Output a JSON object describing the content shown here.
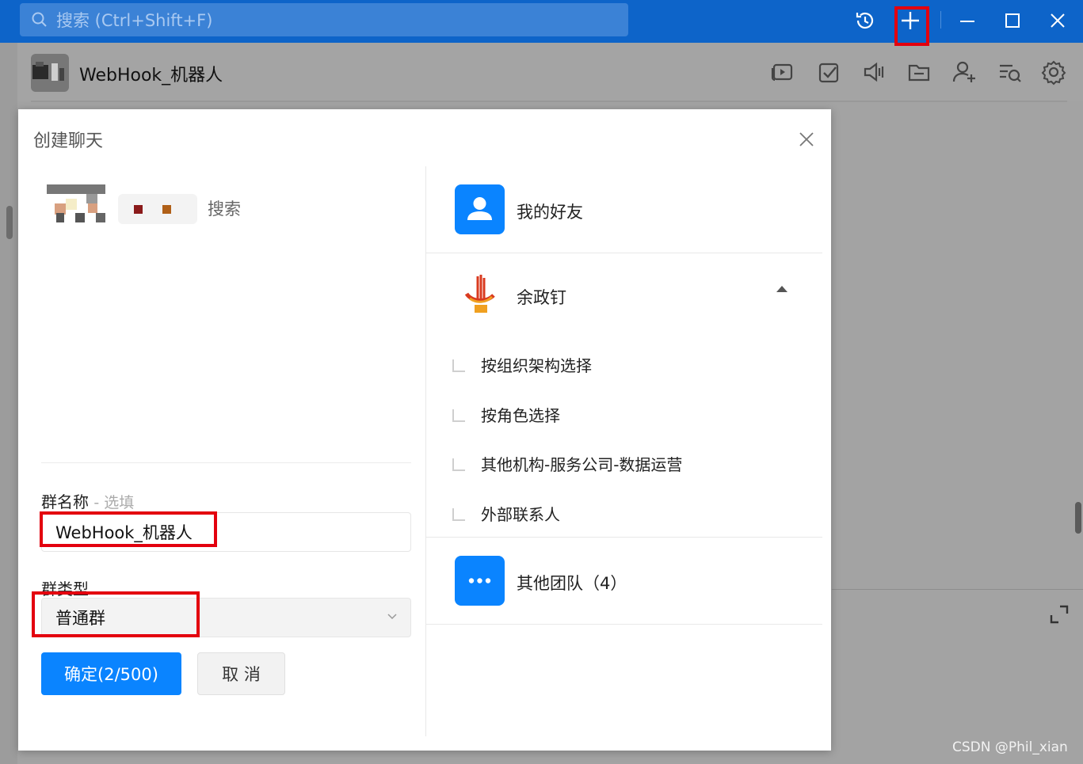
{
  "titlebar": {
    "search_placeholder": "搜索 (Ctrl+Shift+F)"
  },
  "chat": {
    "title": "WebHook_机器人"
  },
  "dialog": {
    "title": "创建聊天",
    "selected_search_label": "搜索",
    "group_name_label": "群名称",
    "group_name_optional": "- 选填",
    "group_name_value": "WebHook_机器人",
    "group_type_label": "群类型",
    "group_type_value": "普通群",
    "confirm_button": "确定(2/500)",
    "cancel_button": "取 消",
    "sources": {
      "friends": "我的好友",
      "org": "余政钉",
      "org_items": [
        "按组织架构选择",
        "按角色选择",
        "其他机构-服务公司-数据运营",
        "外部联系人"
      ],
      "other_teams": "其他团队（4）"
    }
  },
  "watermark": "CSDN @Phil_xian",
  "colors": {
    "titlebar": "#0d64c9",
    "accent": "#0a84ff",
    "highlight": "#e3000e"
  }
}
